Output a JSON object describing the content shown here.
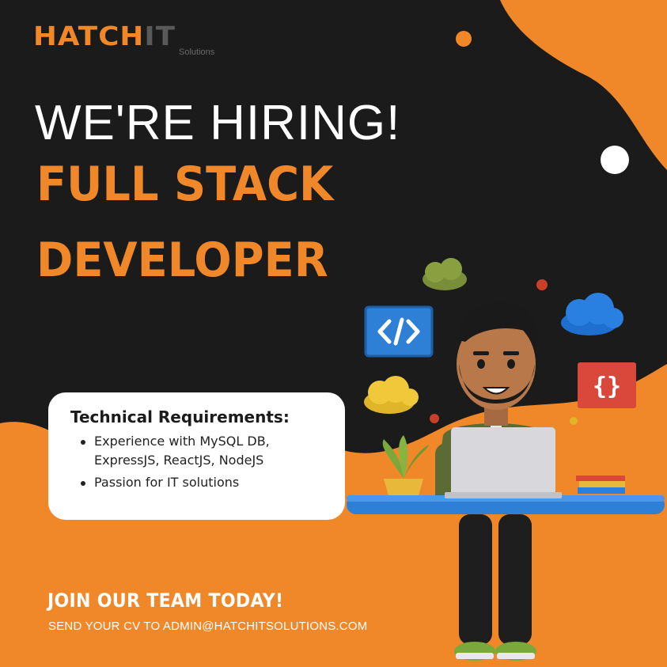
{
  "brand": {
    "logo_part1": "HATCH",
    "logo_part2": "IT",
    "logo_sub": "Solutions"
  },
  "headline": {
    "hiring": "WE'RE HIRING!",
    "role_line1": "FULL STACK",
    "role_line2": "DEVELOPER"
  },
  "requirements": {
    "title": "Technical Requirements:",
    "items": [
      {
        "line1": "Experience with MySQL DB,",
        "line2": "ExpressJS, ReactJS, NodeJS"
      },
      {
        "line1": "Passion for IT solutions",
        "line2": ""
      }
    ]
  },
  "cta": {
    "headline": "JOIN OUR TEAM TODAY!",
    "contact": "SEND YOUR CV TO ADMIN@HATCHITSOLUTIONS.COM"
  },
  "colors": {
    "background": "#1b1b1b",
    "accent_orange": "#f0882a",
    "white": "#ffffff",
    "logo_gray": "#595959"
  },
  "icons": [
    "code-tag-icon",
    "curly-braces-icon",
    "cloud-icon"
  ]
}
